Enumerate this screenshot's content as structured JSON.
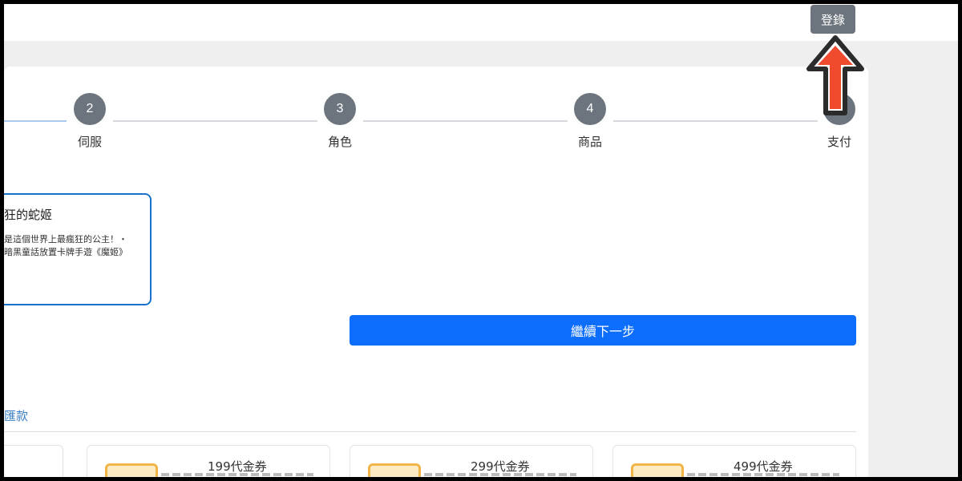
{
  "header": {
    "login_label": "登錄"
  },
  "steps": [
    {
      "number": "2",
      "label": "伺服"
    },
    {
      "number": "3",
      "label": "角色"
    },
    {
      "number": "4",
      "label": "商品"
    },
    {
      "number": "",
      "label": "支付"
    }
  ],
  "game": {
    "title": "狂的蛇姬",
    "description": "是這個世界上最瘋狂的公主！・暗黑童話放置卡牌手遊《魔姬》"
  },
  "next_button": "繼續下一步",
  "payment_link": "匯款",
  "vouchers": [
    {
      "title": "199代金券"
    },
    {
      "title": "299代金券"
    },
    {
      "title": "499代金券"
    }
  ],
  "colors": {
    "primary": "#0d6efd",
    "step_gray": "#6c757d",
    "arrow": "#f04a2f"
  }
}
